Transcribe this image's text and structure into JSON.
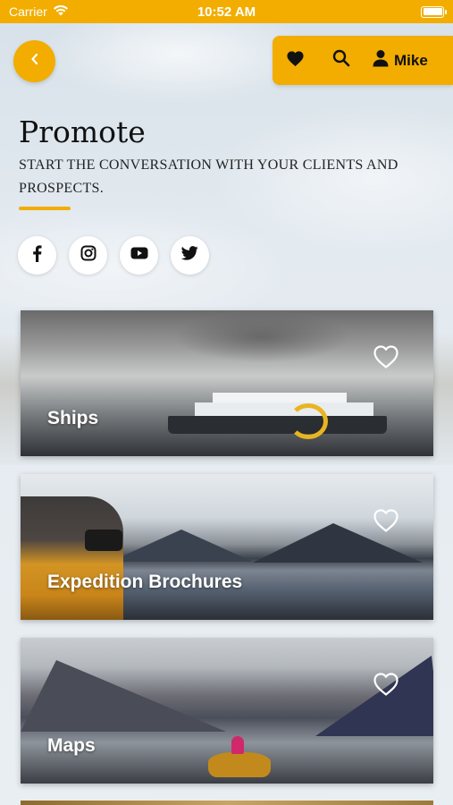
{
  "status_bar": {
    "carrier": "Carrier",
    "time": "10:52 AM"
  },
  "header": {
    "user_name": "Mike"
  },
  "page": {
    "title": "Promote",
    "subtitle": "START THE CONVERSATION WITH YOUR CLIENTS AND PROSPECTS."
  },
  "social": [
    "facebook",
    "instagram",
    "youtube",
    "twitter"
  ],
  "cards": [
    {
      "label": "Ships"
    },
    {
      "label": "Expedition Brochures"
    },
    {
      "label": "Maps"
    }
  ],
  "colors": {
    "accent": "#f2ad00",
    "text": "#111111"
  }
}
